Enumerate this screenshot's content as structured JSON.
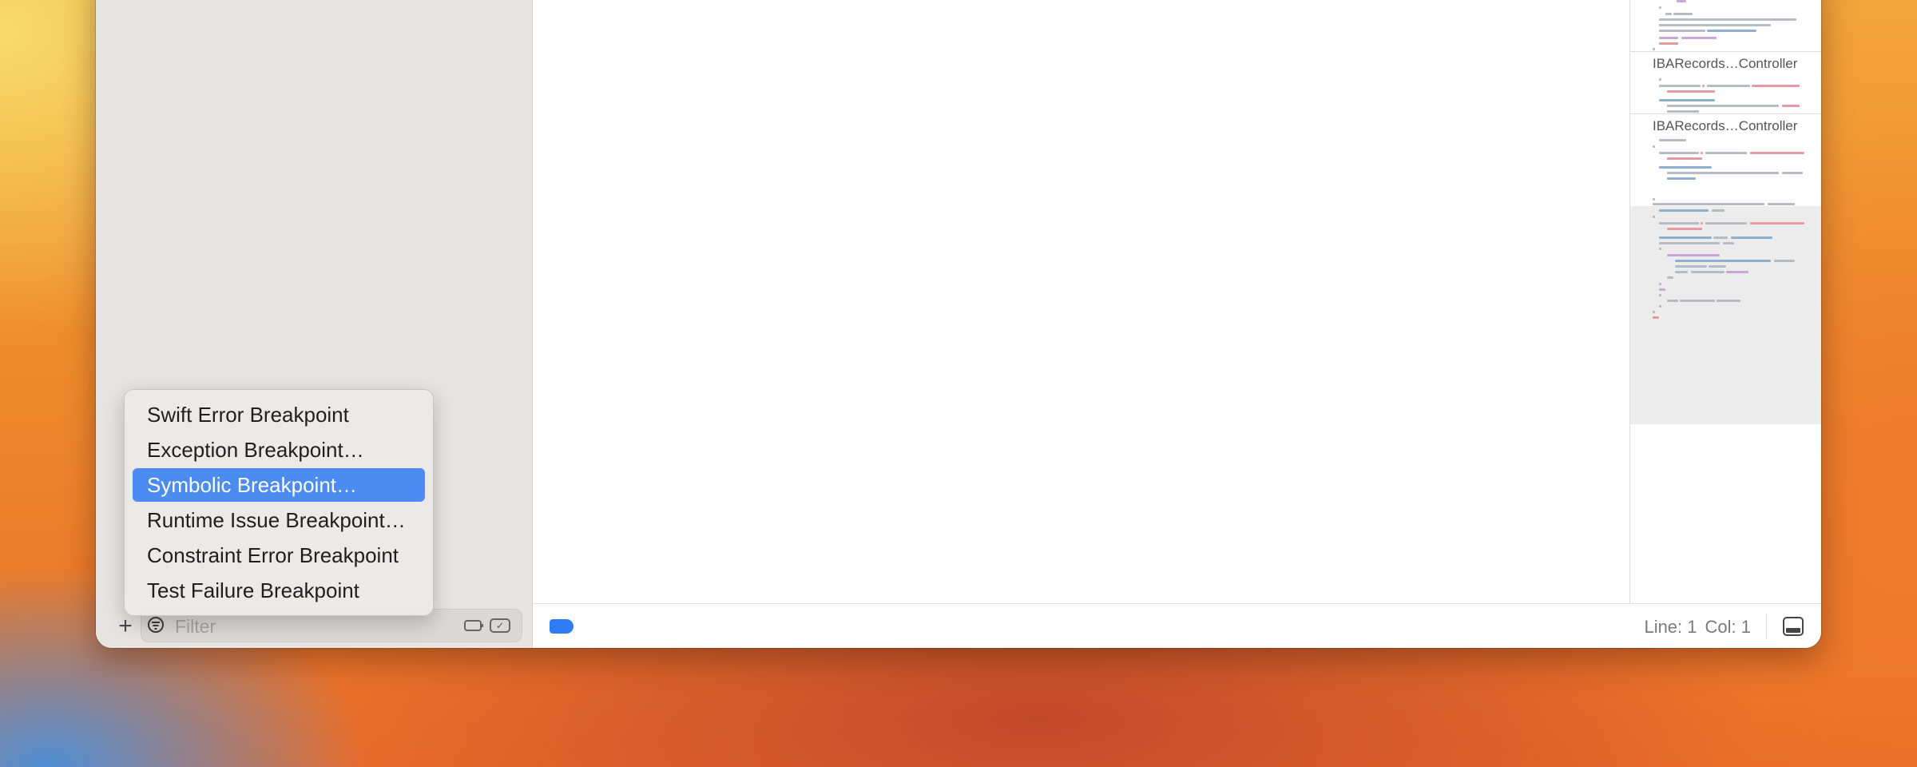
{
  "sidebar": {
    "add_label": "+",
    "filter_placeholder": "Filter",
    "filter_value": ""
  },
  "context_menu": {
    "items": [
      {
        "label": "Swift Error Breakpoint",
        "selected": false
      },
      {
        "label": "Exception Breakpoint…",
        "selected": false
      },
      {
        "label": "Symbolic Breakpoint…",
        "selected": true
      },
      {
        "label": "Runtime Issue Breakpoint…",
        "selected": false
      },
      {
        "label": "Constraint Error Breakpoint",
        "selected": false
      },
      {
        "label": "Test Failure Breakpoint",
        "selected": false
      }
    ]
  },
  "status_bar": {
    "line": "Line: 1",
    "col": "Col: 1"
  },
  "minimap": {
    "sections": [
      {
        "title": "IBARecords…Controller"
      },
      {
        "title": "IBARecords…Controller"
      }
    ]
  },
  "colors": {
    "accent": "#2f7bf6",
    "menu_selection": "#4c8cf0",
    "sidebar_bg": "#e8e4e2"
  }
}
